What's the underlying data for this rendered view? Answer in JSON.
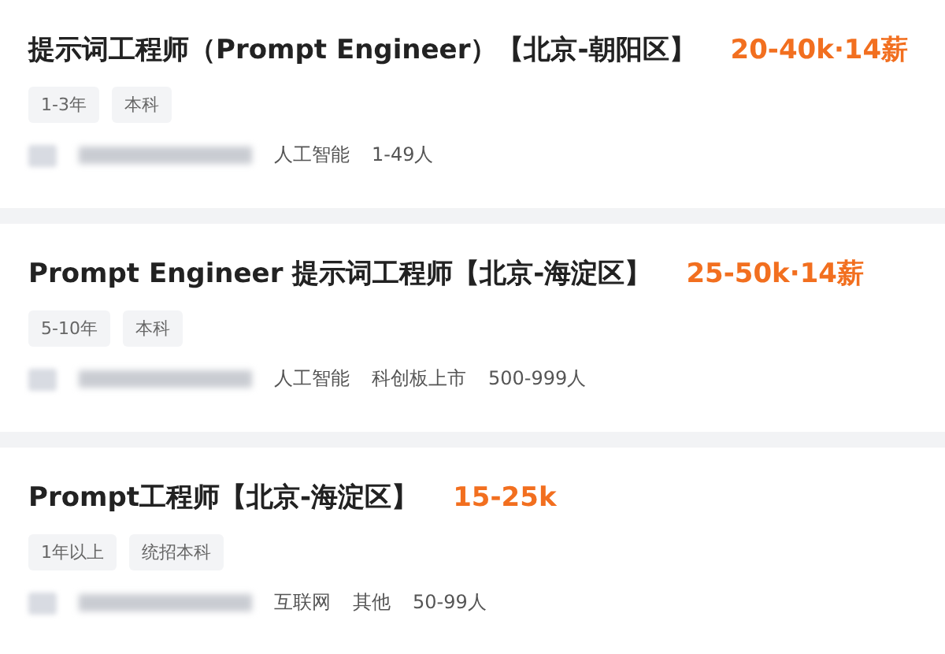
{
  "jobs": [
    {
      "title": "提示词工程师（Prompt Engineer）【北京-朝阳区】",
      "salary": "20-40k·14薪",
      "tags": [
        "1-3年",
        "本科"
      ],
      "company_info": [
        "人工智能",
        "1-49人"
      ]
    },
    {
      "title": "Prompt Engineer 提示词工程师【北京-海淀区】",
      "salary": "25-50k·14薪",
      "tags": [
        "5-10年",
        "本科"
      ],
      "company_info": [
        "人工智能",
        "科创板上市",
        "500-999人"
      ]
    },
    {
      "title": "Prompt工程师【北京-海淀区】",
      "salary": "15-25k",
      "tags": [
        "1年以上",
        "统招本科"
      ],
      "company_info": [
        "互联网",
        "其他",
        "50-99人"
      ]
    }
  ]
}
